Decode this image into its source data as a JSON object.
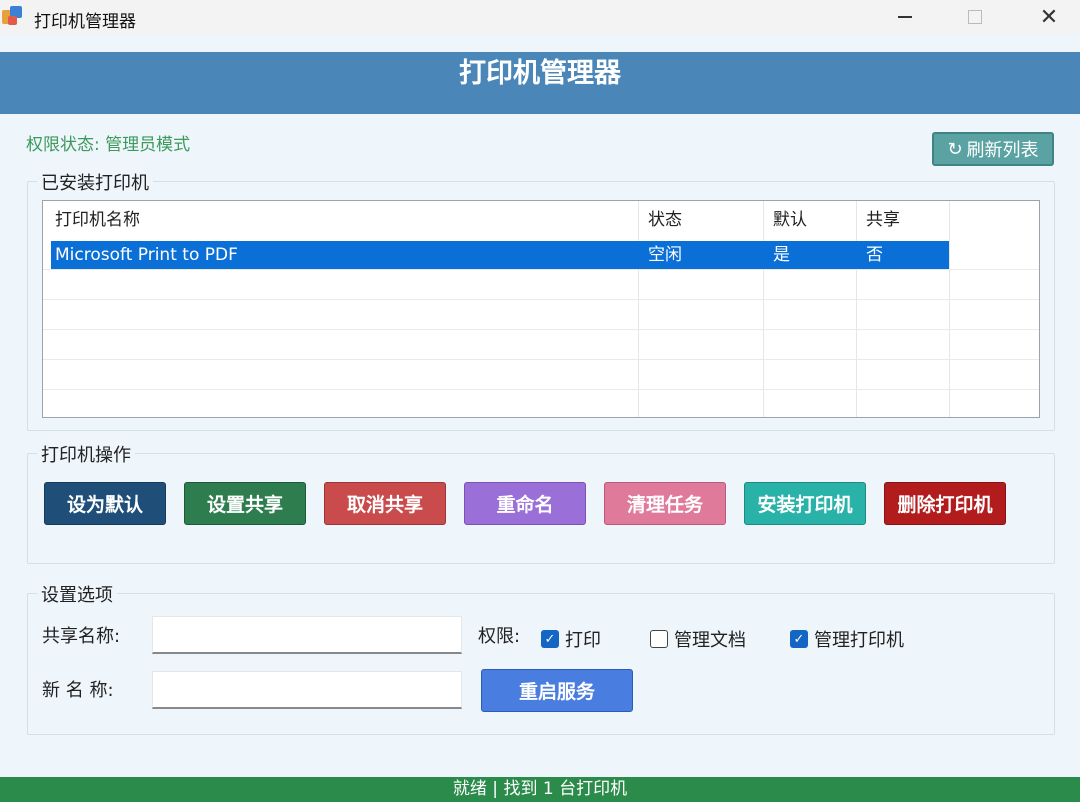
{
  "window": {
    "title": "打印机管理器"
  },
  "header": {
    "title": "打印机管理器"
  },
  "permission": {
    "status": "权限状态: 管理员模式"
  },
  "toolbar": {
    "refresh_label": "刷新列表",
    "refresh_icon": "↻"
  },
  "printers": {
    "group_label": "已安装打印机",
    "columns": [
      "打印机名称",
      "状态",
      "默认",
      "共享"
    ],
    "rows": [
      [
        "Microsoft Print to PDF",
        "空闲",
        "是",
        "否"
      ]
    ]
  },
  "actions": {
    "group_label": "打印机操作",
    "buttons": [
      {
        "label": "设为默认",
        "color": "#1f4e79"
      },
      {
        "label": "设置共享",
        "color": "#2e7d4f"
      },
      {
        "label": "取消共享",
        "color": "#c94b4b"
      },
      {
        "label": "重命名",
        "color": "#9b6fd8"
      },
      {
        "label": "清理任务",
        "color": "#e07a9a"
      },
      {
        "label": "安装打印机",
        "color": "#29b3a8"
      },
      {
        "label": "删除打印机",
        "color": "#b31c1c"
      }
    ]
  },
  "settings": {
    "group_label": "设置选项",
    "share_name_label": "共享名称:",
    "share_name_value": "",
    "new_name_label": "新 名 称:",
    "new_name_value": "",
    "permission_label": "权限:",
    "permissions": [
      {
        "label": "打印",
        "checked": true
      },
      {
        "label": "管理文档",
        "checked": false
      },
      {
        "label": "管理打印机",
        "checked": true
      }
    ],
    "restart_label": "重启服务"
  },
  "status_bar": {
    "text": "就绪 | 找到 1 台打印机"
  },
  "colors": {
    "banner": "#4a86b8",
    "status_bar": "#2b8b4a",
    "selection": "#0a6fd6",
    "refresh": "#5ba3a3",
    "restart": "#4a7de0"
  }
}
